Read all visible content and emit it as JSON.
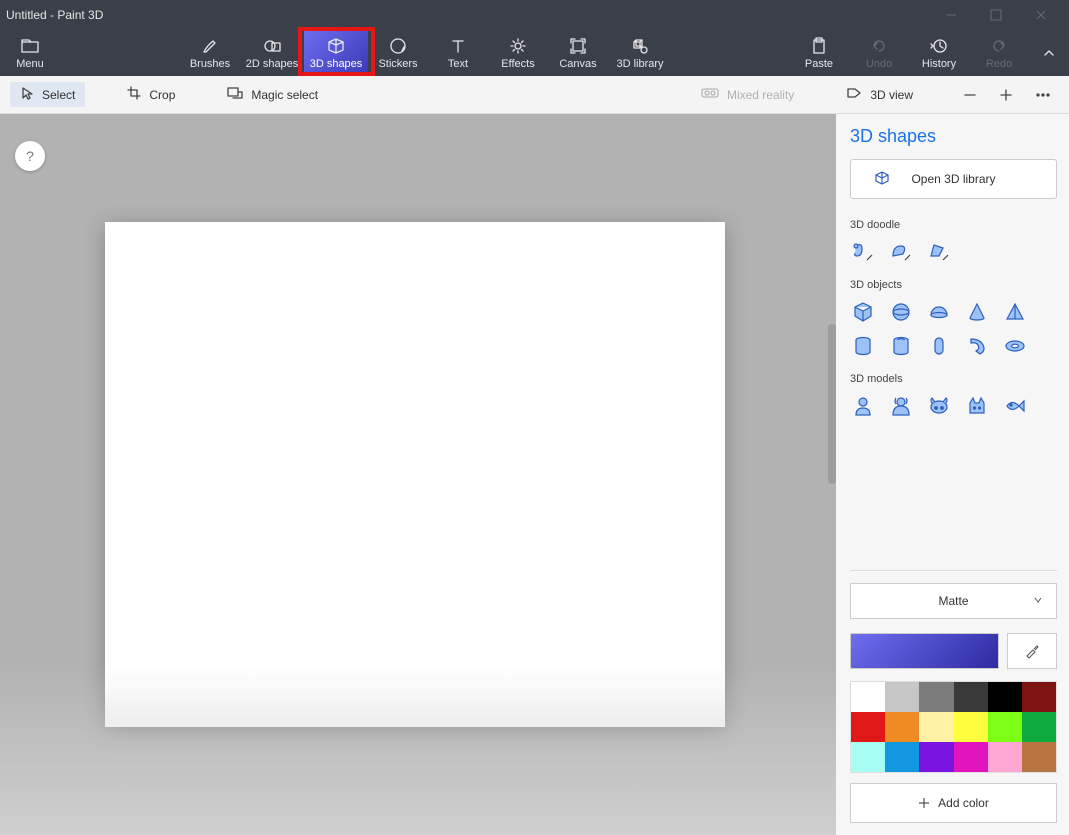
{
  "window": {
    "title": "Untitled - Paint 3D"
  },
  "ribbon": {
    "menu": "Menu",
    "items": [
      {
        "label": "Brushes"
      },
      {
        "label": "2D shapes"
      },
      {
        "label": "3D shapes",
        "selected": true
      },
      {
        "label": "Stickers"
      },
      {
        "label": "Text"
      },
      {
        "label": "Effects"
      },
      {
        "label": "Canvas"
      },
      {
        "label": "3D library"
      }
    ],
    "right": [
      {
        "label": "Paste"
      },
      {
        "label": "Undo",
        "disabled": true
      },
      {
        "label": "History"
      },
      {
        "label": "Redo",
        "disabled": true
      }
    ]
  },
  "subbar": {
    "select": "Select",
    "crop": "Crop",
    "magic": "Magic select",
    "mixed": "Mixed reality",
    "view3d": "3D view"
  },
  "help": "?",
  "panel": {
    "title": "3D shapes",
    "open_library": "Open 3D library",
    "sections": {
      "doodle": "3D doodle",
      "objects": "3D objects",
      "models": "3D models"
    },
    "doodle_items": [
      "tube-doodle",
      "soft-edge-doodle",
      "sharp-edge-doodle"
    ],
    "object_items": [
      "cube",
      "sphere",
      "hemisphere",
      "cone",
      "pyramid",
      "cylinder",
      "tube",
      "capsule",
      "curved-cylinder",
      "donut"
    ],
    "model_items": [
      "man",
      "woman",
      "dog",
      "cat",
      "fish"
    ],
    "material": "Matte",
    "addcolor": "Add color",
    "colors": [
      "#ffffff",
      "#c6c6c6",
      "#7b7b7b",
      "#393939",
      "#000000",
      "#7c1414",
      "#e11818",
      "#f08a23",
      "#fff2a6",
      "#fffe3e",
      "#7cff14",
      "#0faa3d",
      "#a6fff2",
      "#1497e1",
      "#7b14e1",
      "#e114be",
      "#ffa6d2",
      "#b77641"
    ]
  }
}
